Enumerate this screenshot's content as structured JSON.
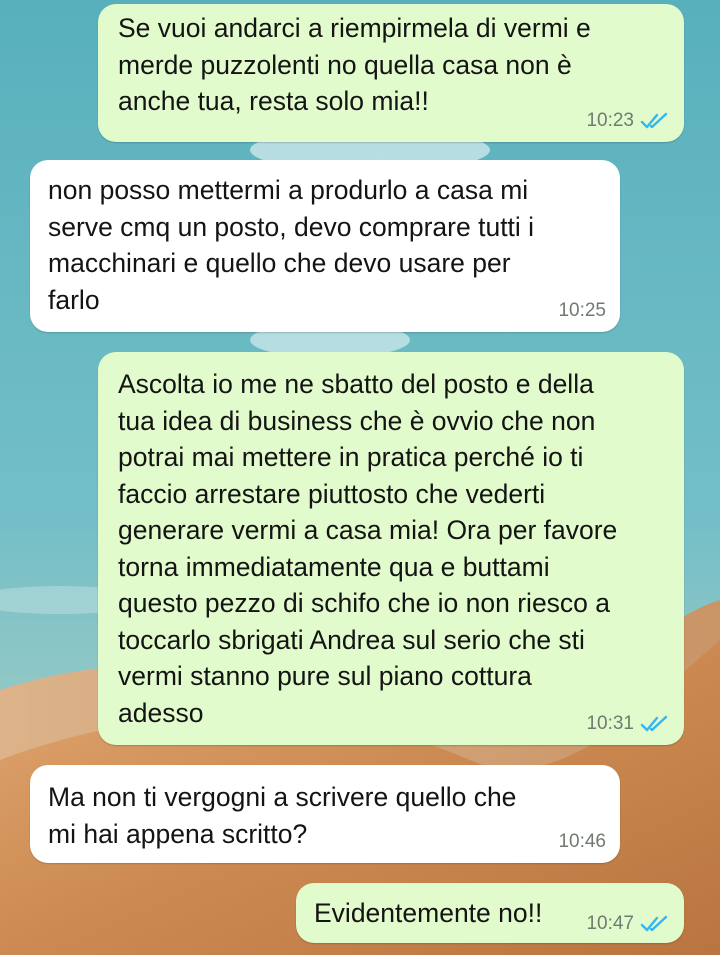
{
  "messages": [
    {
      "direction": "outgoing",
      "text": "Se vuoi andarci a riempirmela di vermi e\nmerde puzzolenti no quella casa non è\nanche tua, resta solo mia!!",
      "time": "10:23",
      "status": "read"
    },
    {
      "direction": "incoming",
      "text": "non posso mettermi a produrlo a casa  mi\nserve cmq un posto, devo comprare tutti i\nmacchinari e quello che devo usare per\nfarlo",
      "time": "10:25"
    },
    {
      "direction": "outgoing",
      "text": "Ascolta io me ne sbatto del posto e della\ntua idea di business che è ovvio che non\npotrai mai mettere in pratica perché io ti\nfaccio arrestare piuttosto che vederti\ngenerare vermi a casa mia! Ora per favore\ntorna immediatamente qua e buttami\nquesto pezzo di schifo che io non riesco a\ntoccarlo sbrigati Andrea sul serio che sti\nvermi stanno pure sul piano cottura\nadesso",
      "time": "10:31",
      "status": "read"
    },
    {
      "direction": "incoming",
      "text": "Ma non ti vergogni a scrivere quello che\nmi hai appena scritto?",
      "time": "10:46"
    },
    {
      "direction": "outgoing",
      "text": "Evidentemente no!!",
      "time": "10:47",
      "status": "read"
    }
  ],
  "colors": {
    "outgoing_bubble": "#e2fbcc",
    "incoming_bubble": "#ffffff",
    "read_ticks": "#34b7f1",
    "timestamp": "#6f7b72",
    "wallpaper_sky": "#5fb4c0",
    "wallpaper_sand": "#c98a55"
  },
  "icons": {
    "read_receipt": "double-check-icon"
  }
}
